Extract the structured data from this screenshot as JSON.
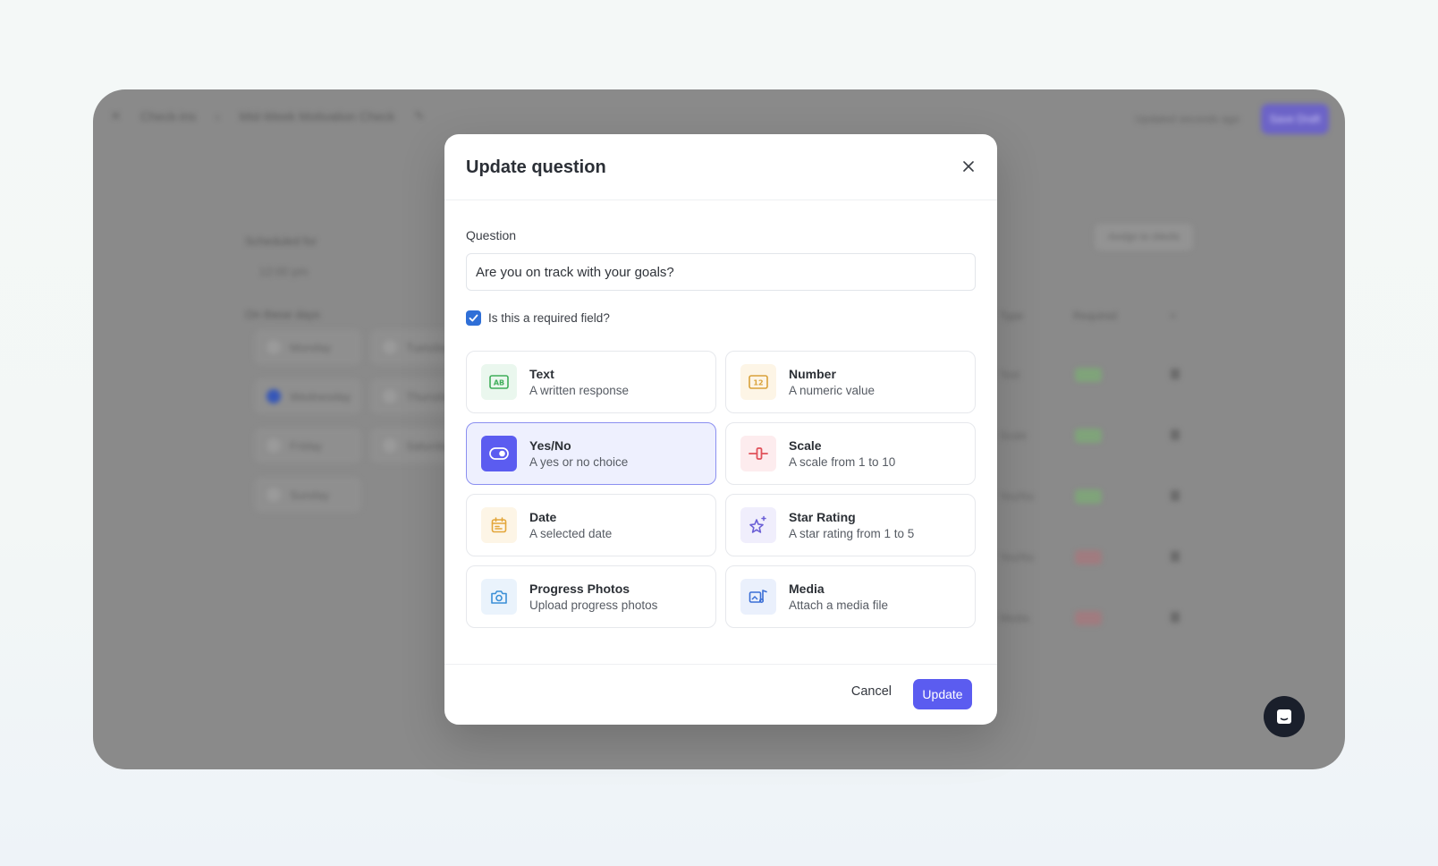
{
  "background_app": {
    "breadcrumb": [
      "Check-ins",
      "Mid-Week Motivation Check"
    ],
    "updated_text": "Updated seconds ago",
    "save_label": "Save Draft",
    "scheduled_label": "Scheduled for",
    "scheduled_value": "12:00 pm",
    "days_label": "On these days",
    "days": [
      {
        "label": "Monday",
        "checked": false
      },
      {
        "label": "Tuesday",
        "checked": false
      },
      {
        "label": "Wednesday",
        "checked": true
      },
      {
        "label": "Thursday",
        "checked": false
      },
      {
        "label": "Friday",
        "checked": false
      },
      {
        "label": "Saturday",
        "checked": false
      },
      {
        "label": "Sunday",
        "checked": false
      }
    ],
    "assign_label": "Assign to clients",
    "table_headers": [
      "Type",
      "Required"
    ],
    "rows": [
      {
        "type": "Text",
        "required": "Yes"
      },
      {
        "type": "Scale",
        "required": "Yes"
      },
      {
        "type": "Yes/No",
        "required": "Yes"
      },
      {
        "type": "Yes/No",
        "required": "No"
      },
      {
        "type": "Media",
        "required": "No"
      }
    ]
  },
  "modal": {
    "title": "Update question",
    "question_label": "Question",
    "question_value": "Are you on track with your goals?",
    "required_label": "Is this a required field?",
    "required_checked": true,
    "types": [
      {
        "name": "Text",
        "desc": "A written response",
        "icon": "text-ab-icon",
        "color": "#3fae5a",
        "bg": "#eaf7ee",
        "selected": false
      },
      {
        "name": "Number",
        "desc": "A numeric value",
        "icon": "number-icon",
        "color": "#d9a23a",
        "bg": "#fdf5e6",
        "selected": false
      },
      {
        "name": "Yes/No",
        "desc": "A yes or no choice",
        "icon": "toggle-icon",
        "color": "#ffffff",
        "bg": "#5b5cf0",
        "selected": true
      },
      {
        "name": "Scale",
        "desc": "A scale from 1 to 10",
        "icon": "slider-icon",
        "color": "#e0505a",
        "bg": "#fdecee",
        "selected": false
      },
      {
        "name": "Date",
        "desc": "A selected date",
        "icon": "calendar-icon",
        "color": "#e3a63a",
        "bg": "#fdf5e6",
        "selected": false
      },
      {
        "name": "Star Rating",
        "desc": "A star rating from 1 to 5",
        "icon": "star-sparkle-icon",
        "color": "#6b5fd6",
        "bg": "#f0eefc",
        "selected": false
      },
      {
        "name": "Progress Photos",
        "desc": "Upload progress photos",
        "icon": "camera-icon",
        "color": "#3b8fd6",
        "bg": "#eaf3fc",
        "selected": false
      },
      {
        "name": "Media",
        "desc": "Attach a media file",
        "icon": "media-icon",
        "color": "#3b6fd6",
        "bg": "#eaf0fc",
        "selected": false
      }
    ],
    "cancel_label": "Cancel",
    "update_label": "Update"
  }
}
